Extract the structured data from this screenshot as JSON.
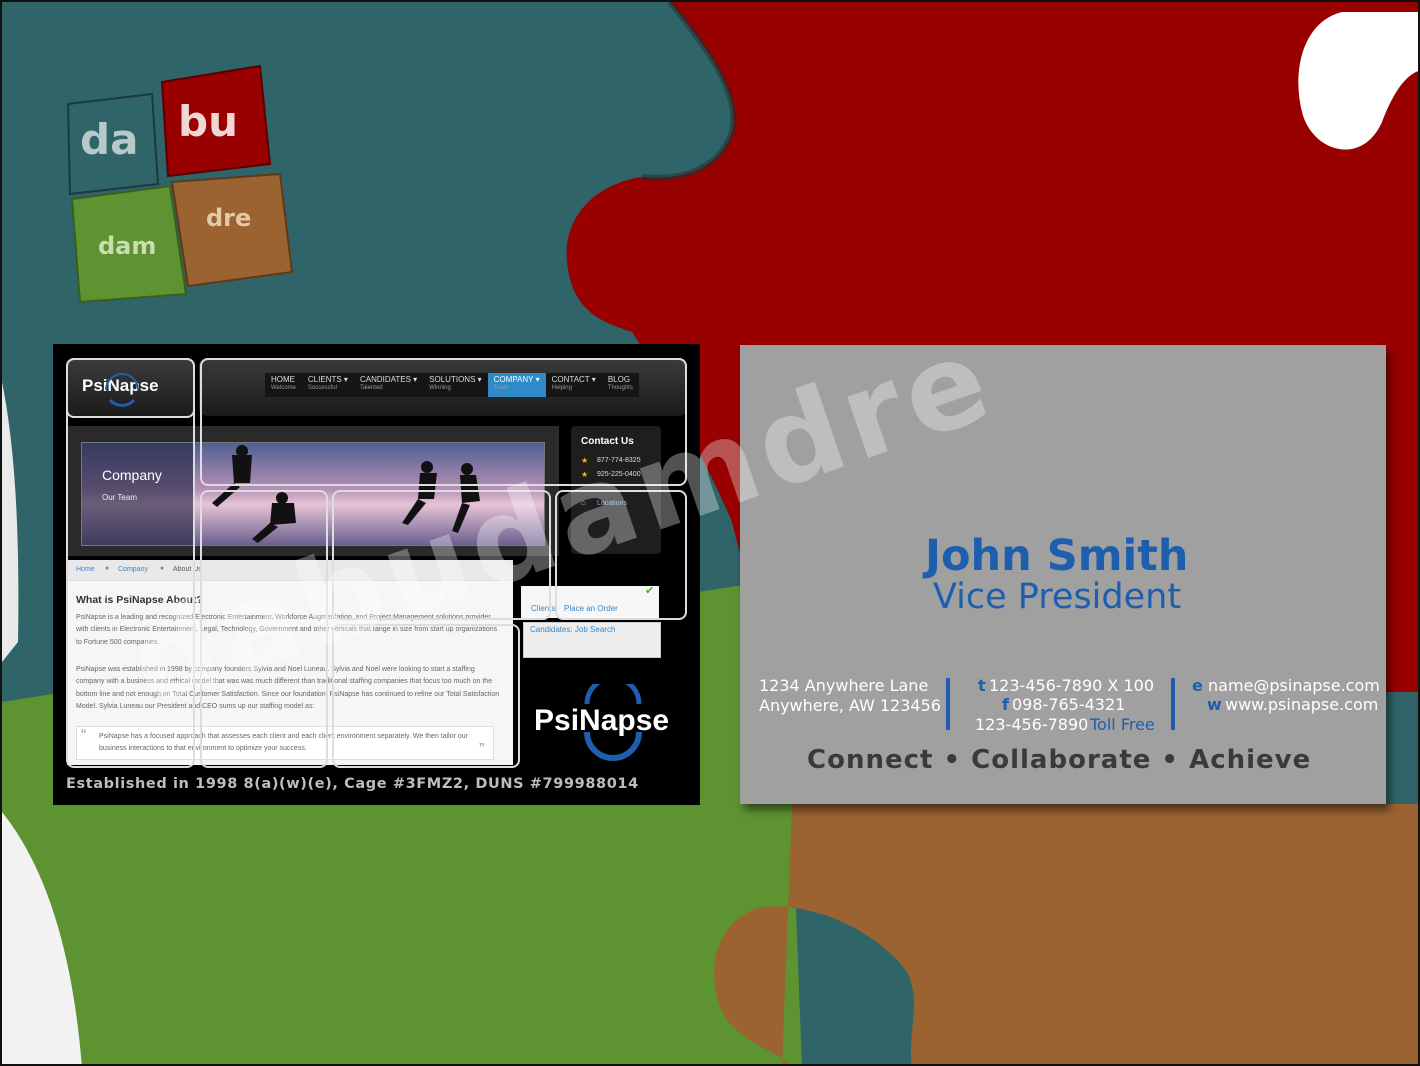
{
  "logo": {
    "pieces": [
      "da",
      "bu",
      "dam",
      "dre"
    ]
  },
  "site": {
    "brand": "PsiNapse",
    "nav": [
      {
        "label": "HOME",
        "sub": "Welcome"
      },
      {
        "label": "CLIENTS",
        "sub": "Successful"
      },
      {
        "label": "CANDIDATES",
        "sub": "Talented"
      },
      {
        "label": "SOLUTIONS",
        "sub": "Winning"
      },
      {
        "label": "COMPANY",
        "sub": "Team"
      },
      {
        "label": "CONTACT",
        "sub": "Helping"
      },
      {
        "label": "BLOG",
        "sub": "Thoughts"
      }
    ],
    "hero_title": "Company",
    "hero_sub": "Our Team",
    "contact": {
      "heading": "Contact Us",
      "phone1": "877-774-8325",
      "phone2": "925-225-0400",
      "locations": "Locations"
    },
    "breadcrumb": {
      "home": "Home",
      "company": "Company",
      "about": "About Us"
    },
    "about_heading": "What is PsiNapse About?",
    "para1": "PsiNapse is a leading and recognized Electronic Entertainment, Workforce Augmentation, and Project Management solutions provider with clients in Electronic Entertainment, Legal, Technology, Government and other verticals that range in size from start up organizations to Fortune 500 companies.",
    "para2": "PsiNapse was established in 1998 by company founders Sylvia and Noel Luneau. Sylvia and Noel were looking to start a staffing company with a business and ethical model that was was much different than traditional staffing companies that focus too much on the bottom line and not enough on Total Customer Satisfaction. Since our foundation, PsiNapse has continued to refine our Total Satisfaction Model. Sylvia Luneau our President and CEO sums up our staffing model as:",
    "quote": "PsiNapse has a focused approach that assesses each client and each client environment separately. We then tailor our business interactions to that environment to optimize your success.",
    "clients_link": "Clients",
    "order_link": "Place an Order",
    "candidates_link": "Candidates: Job Search",
    "footer": "Established in 1998 8(a)(w)(e), Cage #3FMZ2, DUNS #799988014"
  },
  "card": {
    "name": "John Smith",
    "title": "Vice President",
    "address1": "1234 Anywhere Lane",
    "address2": "Anywhere, AW 123456",
    "t_label": "t",
    "phone": "123-456-7890 X 100",
    "f_label": "f",
    "fax": "098-765-4321",
    "tollfree_num": "123-456-7890",
    "tollfree_label": "Toll Free",
    "e_label": "e",
    "email": "name@psinapse.com",
    "w_label": "w",
    "web": "www.psinapse.com",
    "tagline": "Connect • Collaborate • Achieve"
  },
  "watermark": "dabudamdre",
  "colors": {
    "teal": "#2f6468",
    "red": "#990000",
    "green": "#5e9331",
    "brown": "#9b6331",
    "accent_blue": "#1d5fae",
    "card_gray": "#a0a0a0"
  }
}
